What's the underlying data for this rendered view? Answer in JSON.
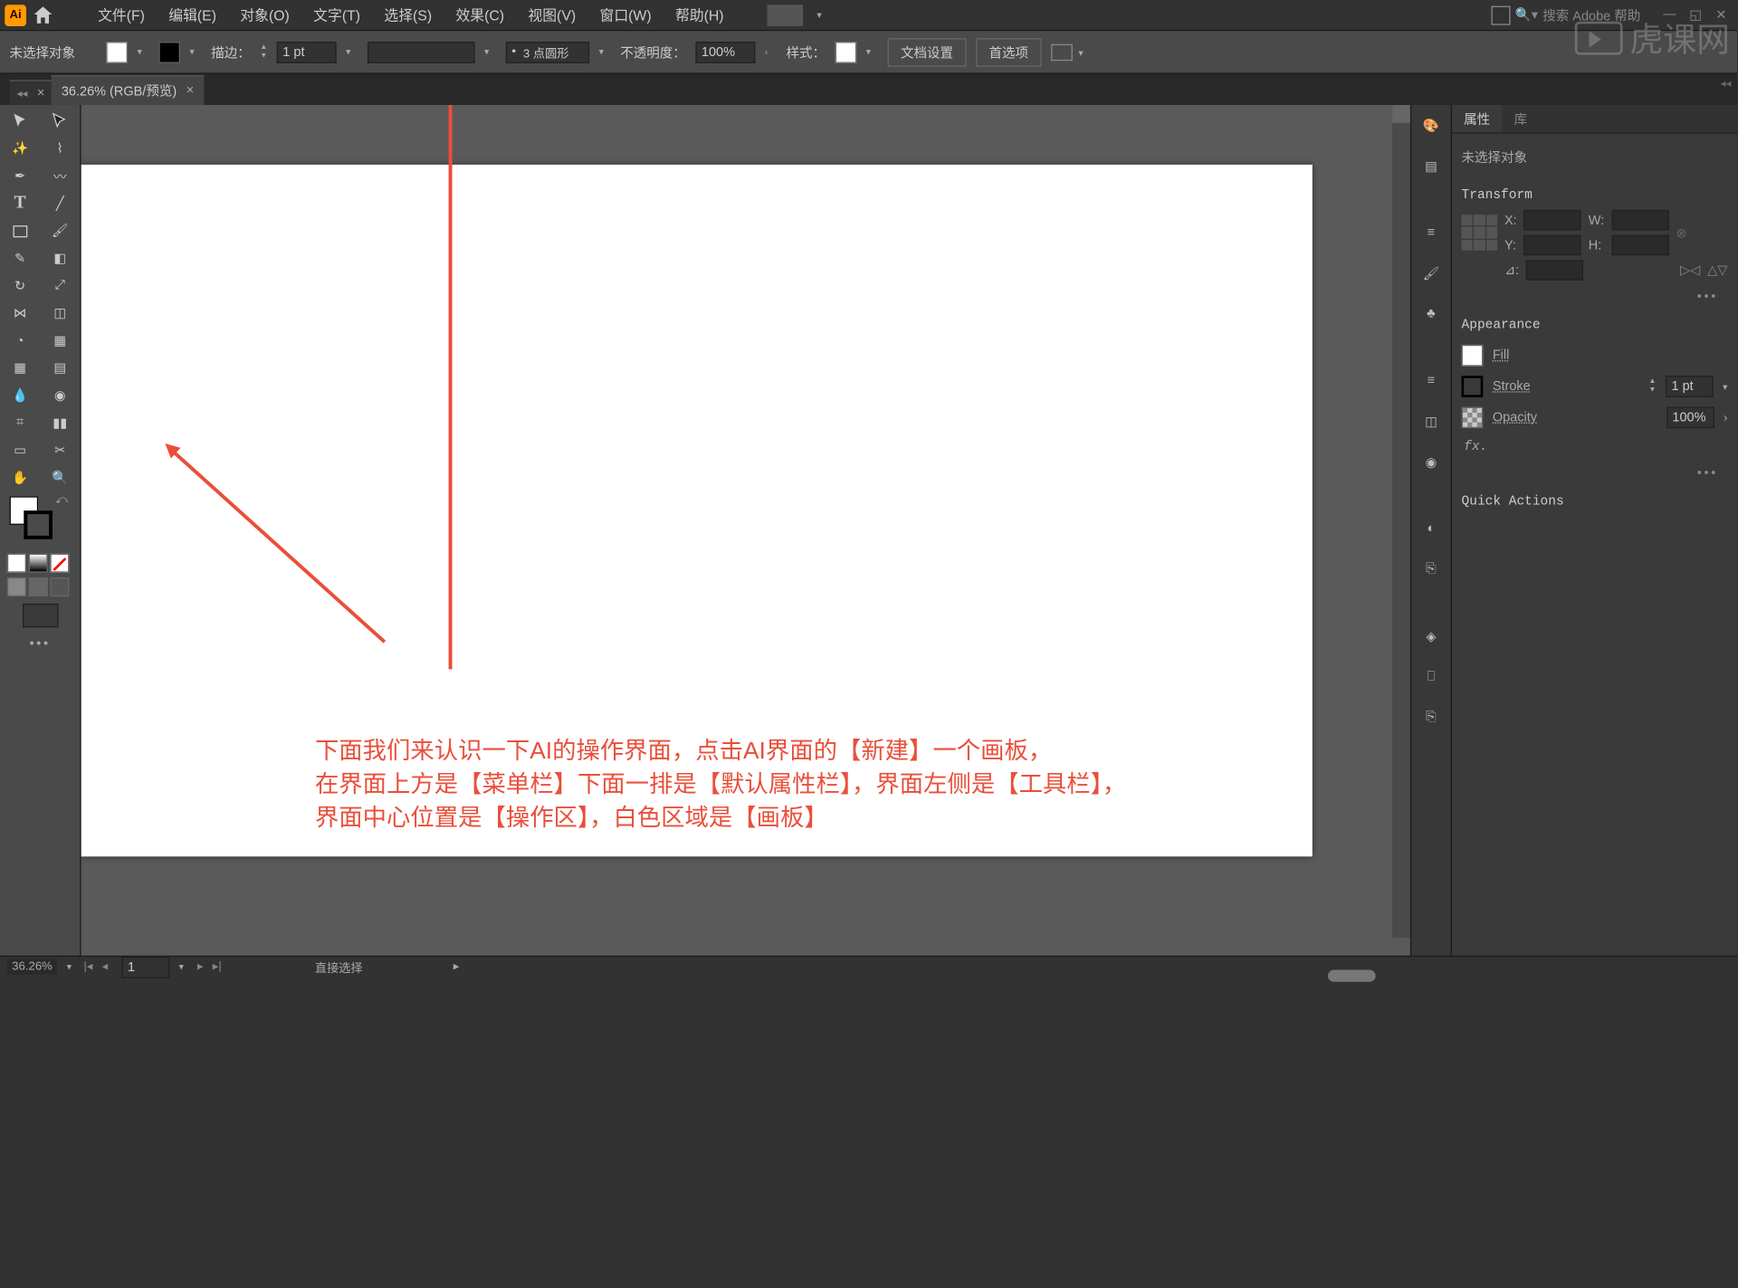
{
  "menu": {
    "items": [
      "文件(F)",
      "编辑(E)",
      "对象(O)",
      "文字(T)",
      "选择(S)",
      "效果(C)",
      "视图(V)",
      "窗口(W)",
      "帮助(H)"
    ],
    "search_placeholder": "搜索 Adobe 帮助"
  },
  "control": {
    "no_selection": "未选择对象",
    "stroke_label": "描边：",
    "stroke_weight": "1 pt",
    "point_shape": "3 点圆形",
    "opacity_label": "不透明度：",
    "opacity_value": "100%",
    "style_label": "样式：",
    "doc_setup": "文档设置",
    "prefs": "首选项"
  },
  "tabs": {
    "doc_title": "36.26% (RGB/预览)"
  },
  "annotation": {
    "line1": "下面我们来认识一下AI的操作界面，点击AI界面的【新建】一个画板，",
    "line2": "在界面上方是【菜单栏】下面一排是【默认属性栏】，界面左侧是【工具栏】，",
    "line3": "界面中心位置是【操作区】，白色区域是【画板】"
  },
  "properties": {
    "tab_props": "属性",
    "tab_lib": "库",
    "no_sel": "未选择对象",
    "transform": "Transform",
    "x_label": "X:",
    "y_label": "Y:",
    "w_label": "W:",
    "h_label": "H:",
    "angle_label": "⊿:",
    "appearance": "Appearance",
    "fill": "Fill",
    "stroke": "Stroke",
    "stroke_val": "1 pt",
    "opacity": "Opacity",
    "opacity_val": "100%",
    "fx": "fx.",
    "quick": "Quick Actions"
  },
  "status": {
    "zoom": "36.26%",
    "artboard": "1",
    "tool": "直接选择"
  },
  "watermark": "虎课网"
}
